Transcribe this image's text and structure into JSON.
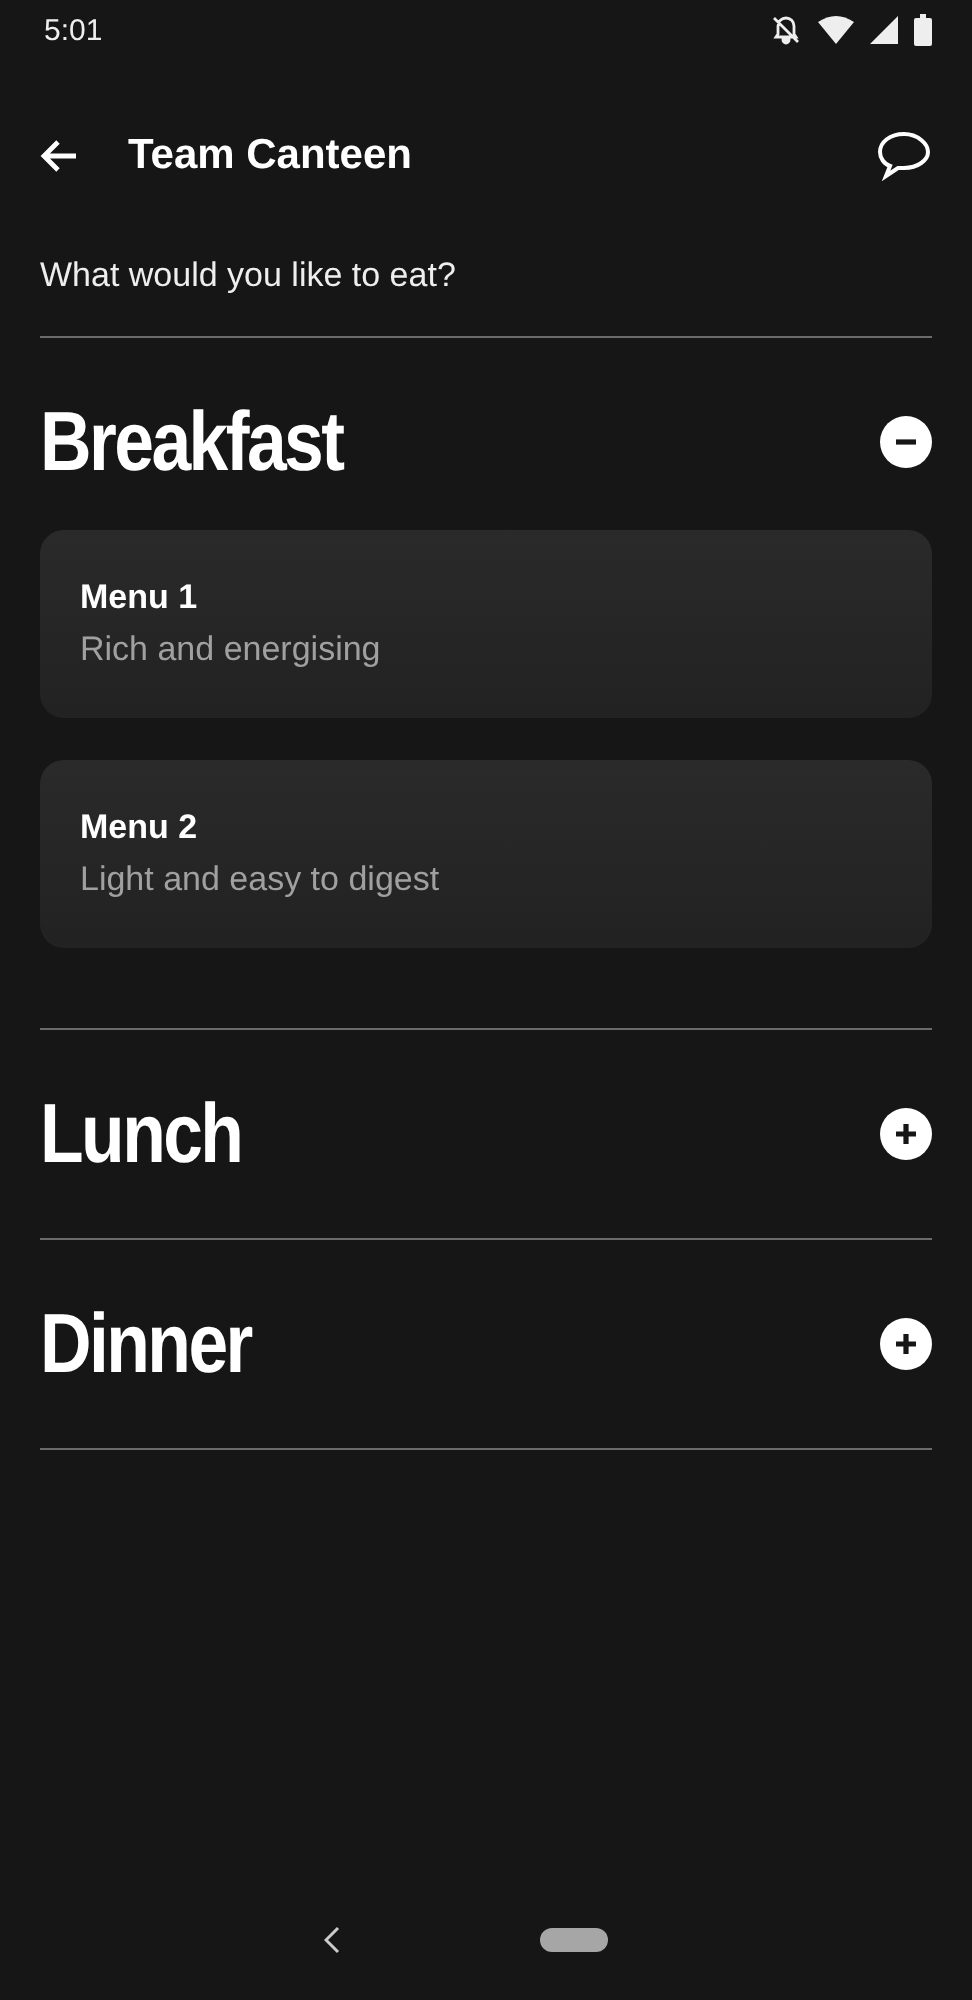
{
  "status_bar": {
    "time": "5:01"
  },
  "app_bar": {
    "title": "Team Canteen"
  },
  "prompt": "What would you like to eat?",
  "sections": [
    {
      "title": "Breakfast",
      "expanded": true,
      "menus": [
        {
          "name": "Menu 1",
          "description": "Rich and energising"
        },
        {
          "name": "Menu 2",
          "description": "Light and easy to digest"
        }
      ]
    },
    {
      "title": "Lunch",
      "expanded": false
    },
    {
      "title": "Dinner",
      "expanded": false
    }
  ]
}
